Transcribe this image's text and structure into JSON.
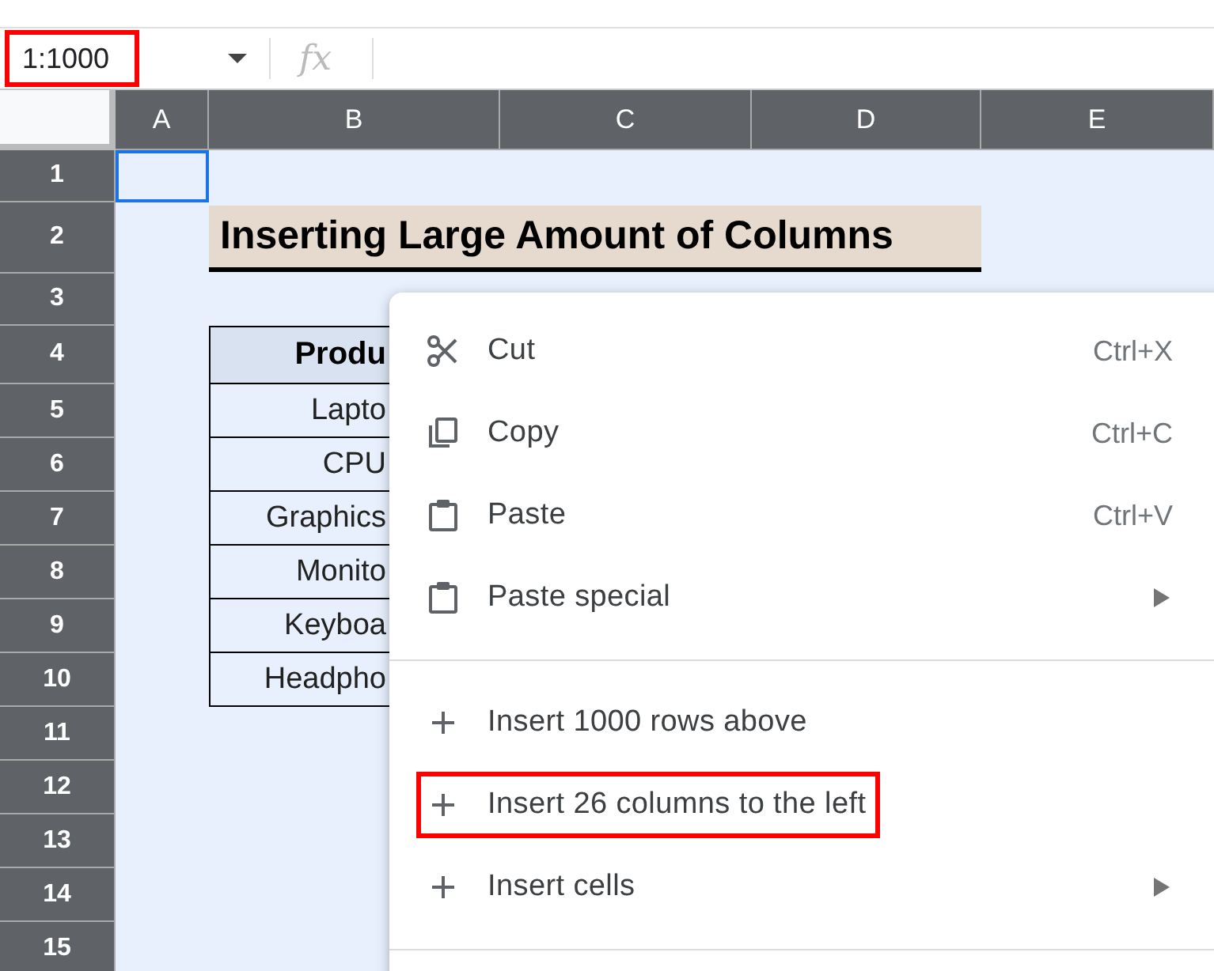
{
  "name_box": {
    "value": "1:1000",
    "highlighted": true
  },
  "formula_bar": {
    "icon_text": "fx"
  },
  "columns": [
    {
      "label": "A",
      "selected": true
    },
    {
      "label": "B",
      "selected": true
    },
    {
      "label": "C",
      "selected": true
    },
    {
      "label": "D",
      "selected": true
    },
    {
      "label": "E",
      "selected": true
    }
  ],
  "rows": [
    {
      "label": "1",
      "selected": true
    },
    {
      "label": "2",
      "selected": true
    },
    {
      "label": "3",
      "selected": true
    },
    {
      "label": "4",
      "selected": true
    },
    {
      "label": "5",
      "selected": true
    },
    {
      "label": "6",
      "selected": true
    },
    {
      "label": "7",
      "selected": true
    },
    {
      "label": "8",
      "selected": true
    },
    {
      "label": "9",
      "selected": true
    },
    {
      "label": "10",
      "selected": true
    },
    {
      "label": "11",
      "selected": true
    },
    {
      "label": "12",
      "selected": true
    },
    {
      "label": "13",
      "selected": true
    },
    {
      "label": "14",
      "selected": true
    },
    {
      "label": "15",
      "selected": true
    }
  ],
  "title": "Inserting Large Amount of Columns",
  "table": {
    "header": "Produ",
    "cells": [
      "Lapto",
      "CPU",
      "Graphics",
      "Monito",
      "Keyboa",
      "Headpho"
    ]
  },
  "context_menu": [
    {
      "kind": "cut",
      "label": "Cut",
      "shortcut": "Ctrl+X",
      "submenu": false,
      "highlighted": false
    },
    {
      "kind": "copy",
      "label": "Copy",
      "shortcut": "Ctrl+C",
      "submenu": false,
      "highlighted": false
    },
    {
      "kind": "paste",
      "label": "Paste",
      "shortcut": "Ctrl+V",
      "submenu": false,
      "highlighted": false
    },
    {
      "kind": "paste",
      "label": "Paste special",
      "submenu": true,
      "highlighted": false
    },
    {
      "kind": "separator"
    },
    {
      "kind": "insert",
      "label": "Insert 1000 rows above",
      "submenu": false,
      "highlighted": false
    },
    {
      "kind": "insert",
      "label": "Insert 26 columns to the left",
      "submenu": false,
      "highlighted": true
    },
    {
      "kind": "insert",
      "label": "Insert cells",
      "submenu": true,
      "highlighted": false
    },
    {
      "kind": "separator"
    }
  ]
}
